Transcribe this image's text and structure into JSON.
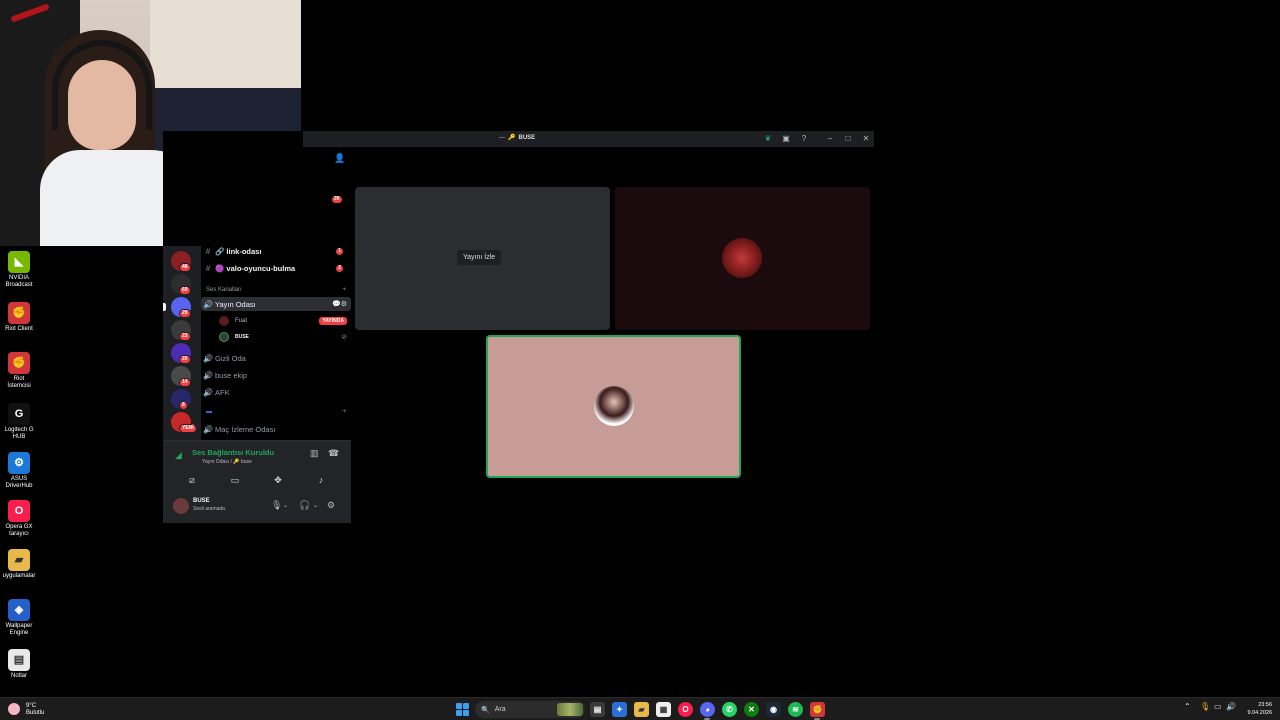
{
  "desktop": {
    "icons": [
      {
        "label": "NVIDIA Broadcast",
        "color": "#76b900"
      },
      {
        "label": "Riot Client",
        "color": "#d13639"
      },
      {
        "label": "Riot İstemcisi",
        "color": "#d13639"
      },
      {
        "label": "Logitech G HUB",
        "color": "#111111"
      },
      {
        "label": "ASUS DriverHub",
        "color": "#1c7ad6"
      },
      {
        "label": "Opera GX tarayıcı",
        "color": "#fa1e4e"
      },
      {
        "label": "uygulamalar",
        "color": "#e8b94a"
      },
      {
        "label": "Wallpaper Engine",
        "color": "#2460c8"
      },
      {
        "label": "Notlar",
        "color": "#e9e9e9"
      }
    ]
  },
  "discord": {
    "window_title": "BUSE",
    "titlebar_buttons": [
      "minimize",
      "maximize",
      "close"
    ],
    "unread_count": "26",
    "servers": [
      {
        "badge": "48",
        "color": "#8a1f24"
      },
      {
        "badge": "69",
        "color": "#2d2d2d"
      },
      {
        "badge": "29",
        "color": "#5865f2"
      },
      {
        "badge": "23",
        "color": "#3b3b3b"
      },
      {
        "badge": "20",
        "color": "#4e2bb5"
      },
      {
        "badge": "14",
        "color": "#4a4a4a"
      },
      {
        "badge": "8",
        "color": "#27276b"
      },
      {
        "badge": "YENİ",
        "color": "#c62828"
      }
    ],
    "text_channels": [
      {
        "name": "🔗 link-odası",
        "badge": "1"
      },
      {
        "name": "🟣 valo-oyuncu-bulma",
        "badge": "2"
      }
    ],
    "voice_category": "Ses Kanalları",
    "voice_channels": [
      {
        "name": "Yayın Odası",
        "active": true
      },
      {
        "name": "Gizli Oda",
        "active": false
      },
      {
        "name": "buse ekip",
        "active": false
      },
      {
        "name": "AFK",
        "active": false
      },
      {
        "name": "Maç İzleme Odası",
        "active": false
      }
    ],
    "voice_users": [
      {
        "name": "Fuat",
        "live": "YAYINDA"
      },
      {
        "name": "BUSE",
        "live": ""
      }
    ],
    "connection": {
      "status": "Ses Bağlantısı Kuruldu",
      "location": "Yayın Odası / 🔑 buse"
    },
    "user": {
      "name": "BUSE",
      "status": "Sesli aramada"
    },
    "stage": {
      "watch_stream_label": "Yayını İzle"
    }
  },
  "taskbar": {
    "weather_temp": "9°C",
    "weather_desc": "Bulutlu",
    "search_placeholder": "Ara",
    "time": "23:56",
    "date": "9.04.2026"
  }
}
